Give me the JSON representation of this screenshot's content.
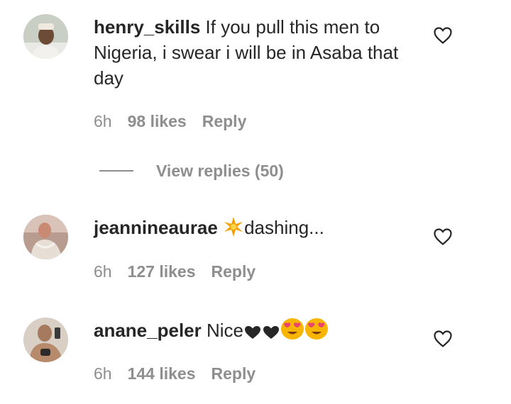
{
  "comments": [
    {
      "username": "henry_skills",
      "text": "If you pull this men to Nigeria, i swear i will be in Asaba that day",
      "time": "6h",
      "likes": "98 likes",
      "reply_label": "Reply",
      "view_replies_label": "View replies (50)",
      "avatar_icon": "avatar-photo-icon",
      "like_icon": "heart-outline-icon"
    },
    {
      "username": "jeannineaurae",
      "text": "dashing...",
      "emoji_prefix": "sparkle-star-emoji",
      "time": "6h",
      "likes": "127 likes",
      "reply_label": "Reply",
      "avatar_icon": "avatar-photo-icon",
      "like_icon": "heart-outline-icon"
    },
    {
      "username": "anane_peler",
      "text": "Nice",
      "emoji_suffix": [
        "black-heart-emoji",
        "black-heart-emoji",
        "heart-eyes-emoji",
        "heart-eyes-emoji"
      ],
      "time": "6h",
      "likes": "144 likes",
      "reply_label": "Reply",
      "avatar_icon": "avatar-photo-icon",
      "like_icon": "heart-outline-icon"
    }
  ],
  "colors": {
    "text": "#262626",
    "meta": "#8e8e8e",
    "background": "#ffffff"
  }
}
